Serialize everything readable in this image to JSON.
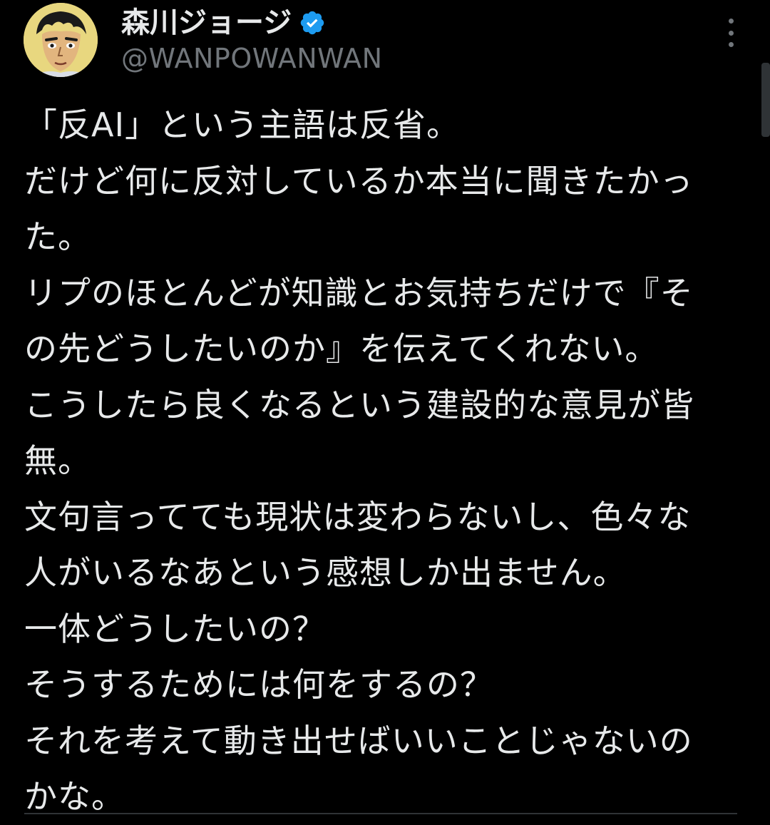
{
  "author": {
    "display_name": "森川ジョージ",
    "handle": "@WANPOWANWAN",
    "verified": true,
    "avatar_icon": "boxer-avatar-icon"
  },
  "post": {
    "lines": [
      "「反AI」という主語は反省。",
      "だけど何に反対しているか本当に聞きたかっ",
      "た。",
      "リプのほとんどが知識とお気持ちだけで『そ",
      "の先どうしたいのか』を伝えてくれない。",
      "こうしたら良くなるという建設的な意見が皆",
      "無。",
      "文句言ってても現状は変わらないし、色々な",
      "人がいるなあという感想しか出ません。",
      "一体どうしたいの？",
      "そうするためには何をするの？",
      "それを考えて動き出せばいいことじゃないの",
      "かな。"
    ]
  },
  "colors": {
    "background": "#000000",
    "text_primary": "#e7e9ea",
    "text_secondary": "#71767b",
    "verified_badge": "#1d9bf0"
  }
}
